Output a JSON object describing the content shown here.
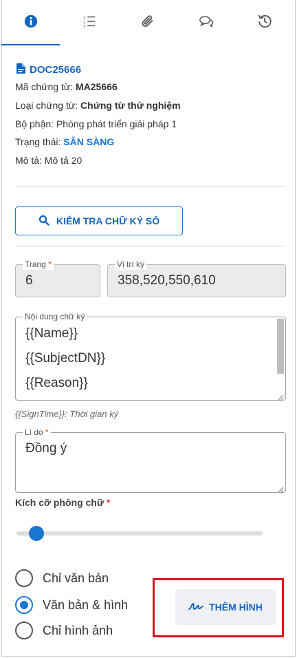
{
  "tabs": [
    {
      "icon": "info-icon",
      "active": true
    },
    {
      "icon": "list-icon",
      "active": false
    },
    {
      "icon": "paperclip-icon",
      "active": false
    },
    {
      "icon": "comments-icon",
      "active": false
    },
    {
      "icon": "history-icon",
      "active": false
    }
  ],
  "document": {
    "code": "DOC25666",
    "voucher_code_label": "Mã chứng từ: ",
    "voucher_code": "MA25666",
    "voucher_type_label": "Loại chứng từ: ",
    "voucher_type": "Chứng từ thử nghiệm",
    "department_label": "Bộ phận: ",
    "department": "Phòng phát triển giải pháp 1",
    "status_label": "Trạng thái: ",
    "status": "SẴN SÀNG",
    "description_label": "Mô tả: ",
    "description": "Mô tả 20"
  },
  "verify_button": "KIỂM TRA CHỮ KÝ SỐ",
  "page_field": {
    "label": "Trang",
    "required": "*",
    "value": "6"
  },
  "position_field": {
    "label": "Vị trí ký",
    "value": "358,520,550,610"
  },
  "signature_content": {
    "label": "Nội dung chữ ký",
    "lines": [
      "{{Name}}",
      "{{SubjectDN}}",
      "{{Reason}}"
    ]
  },
  "hint_text": "{{SignTime}}: Thời gian ký",
  "reason_field": {
    "label": "Lí do",
    "required": "*",
    "value": "Đồng ý"
  },
  "font_size": {
    "label": "Kích cỡ phông chữ",
    "required": "*",
    "level_fraction": 0.08
  },
  "display_mode": {
    "options": [
      {
        "label": "Chỉ văn bản",
        "selected": false
      },
      {
        "label": "Văn bản & hình",
        "selected": true
      },
      {
        "label": "Chỉ hình ảnh",
        "selected": false
      }
    ]
  },
  "add_image_button": "THÊM HÌNH",
  "colors": {
    "accent": "#1976d2",
    "highlight": "#e0101d"
  }
}
